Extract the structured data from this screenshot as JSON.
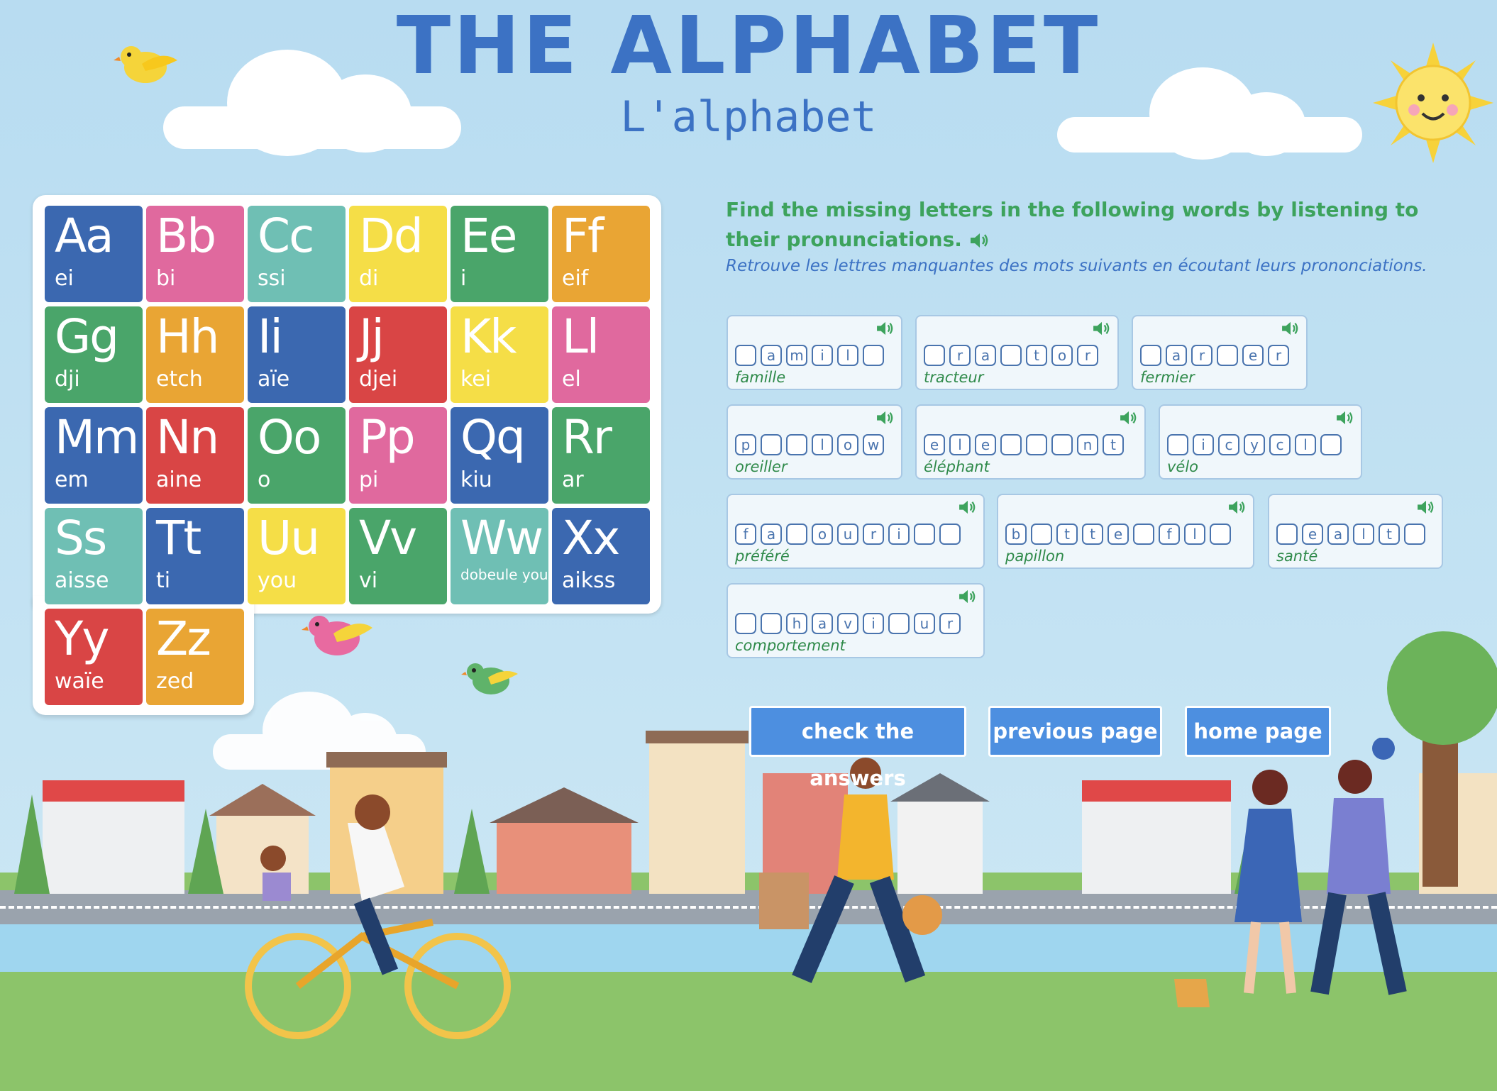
{
  "title": "THE ALPHABET",
  "subtitle": "L'alphabet",
  "alphabet": [
    {
      "letter": "Aa",
      "pron": "ei",
      "color": "#3b68b0"
    },
    {
      "letter": "Bb",
      "pron": "bi",
      "color": "#e0699e"
    },
    {
      "letter": "Cc",
      "pron": "ssi",
      "color": "#6fbfb4"
    },
    {
      "letter": "Dd",
      "pron": "di",
      "color": "#f5de47"
    },
    {
      "letter": "Ee",
      "pron": "i",
      "color": "#4aa56a"
    },
    {
      "letter": "Ff",
      "pron": "eif",
      "color": "#e9a534"
    },
    {
      "letter": "Gg",
      "pron": "dji",
      "color": "#4aa56a"
    },
    {
      "letter": "Hh",
      "pron": "etch",
      "color": "#e9a534"
    },
    {
      "letter": "Ii",
      "pron": "aïe",
      "color": "#3b68b0"
    },
    {
      "letter": "Jj",
      "pron": "djei",
      "color": "#d94545"
    },
    {
      "letter": "Kk",
      "pron": "kei",
      "color": "#f5de47"
    },
    {
      "letter": "Ll",
      "pron": "el",
      "color": "#e0699e"
    },
    {
      "letter": "Mm",
      "pron": "em",
      "color": "#3b68b0"
    },
    {
      "letter": "Nn",
      "pron": "aine",
      "color": "#d94545"
    },
    {
      "letter": "Oo",
      "pron": "o",
      "color": "#4aa56a"
    },
    {
      "letter": "Pp",
      "pron": "pi",
      "color": "#e0699e"
    },
    {
      "letter": "Qq",
      "pron": "kiu",
      "color": "#3b68b0"
    },
    {
      "letter": "Rr",
      "pron": "ar",
      "color": "#4aa56a"
    },
    {
      "letter": "Ss",
      "pron": "aisse",
      "color": "#6fbfb4"
    },
    {
      "letter": "Tt",
      "pron": "ti",
      "color": "#3b68b0"
    },
    {
      "letter": "Uu",
      "pron": "you",
      "color": "#f5de47"
    },
    {
      "letter": "Vv",
      "pron": "vi",
      "color": "#4aa56a"
    },
    {
      "letter": "Ww",
      "pron": "dobeule you",
      "color": "#6fbfb4"
    },
    {
      "letter": "Xx",
      "pron": "aikss",
      "color": "#3b68b0"
    },
    {
      "letter": "Yy",
      "pron": "waïe",
      "color": "#d94545"
    },
    {
      "letter": "Zz",
      "pron": "zed",
      "color": "#e9a534"
    }
  ],
  "instructions": {
    "en": "Find the missing letters in the following words by listening to their pronunciations.",
    "fr": "Retrouve les lettres manquantes des mots suivants en écoutant leurs prononciations."
  },
  "exercises": [
    {
      "letters": [
        "",
        "a",
        "m",
        "i",
        "l",
        ""
      ],
      "fr": "famille"
    },
    {
      "letters": [
        "",
        "r",
        "a",
        "",
        "t",
        "o",
        "r"
      ],
      "fr": "tracteur"
    },
    {
      "letters": [
        "",
        "a",
        "r",
        "",
        "e",
        "r"
      ],
      "fr": "fermier"
    },
    {
      "letters": [
        "p",
        "",
        "",
        "l",
        "o",
        "w"
      ],
      "fr": "oreiller"
    },
    {
      "letters": [
        "e",
        "l",
        "e",
        "",
        "",
        "",
        "n",
        "t"
      ],
      "fr": "éléphant"
    },
    {
      "letters": [
        "",
        "i",
        "c",
        "y",
        "c",
        "l",
        ""
      ],
      "fr": "vélo"
    },
    {
      "letters": [
        "f",
        "a",
        "",
        "o",
        "u",
        "r",
        "i",
        "",
        ""
      ],
      "fr": "préféré"
    },
    {
      "letters": [
        "b",
        "",
        "t",
        "t",
        "e",
        "",
        "f",
        "l",
        ""
      ],
      "fr": "papillon"
    },
    {
      "letters": [
        "",
        "e",
        "a",
        "l",
        "t",
        ""
      ],
      "fr": "santé"
    },
    {
      "letters": [
        "",
        "",
        "h",
        "a",
        "v",
        "i",
        "",
        "u",
        "r"
      ],
      "fr": "comportement"
    }
  ],
  "buttons": {
    "check": "check the answers",
    "previous": "previous page",
    "home": "home page"
  },
  "icons": {
    "speaker": "speaker-icon",
    "sun": "sun-icon",
    "bird": "bird-icon"
  }
}
